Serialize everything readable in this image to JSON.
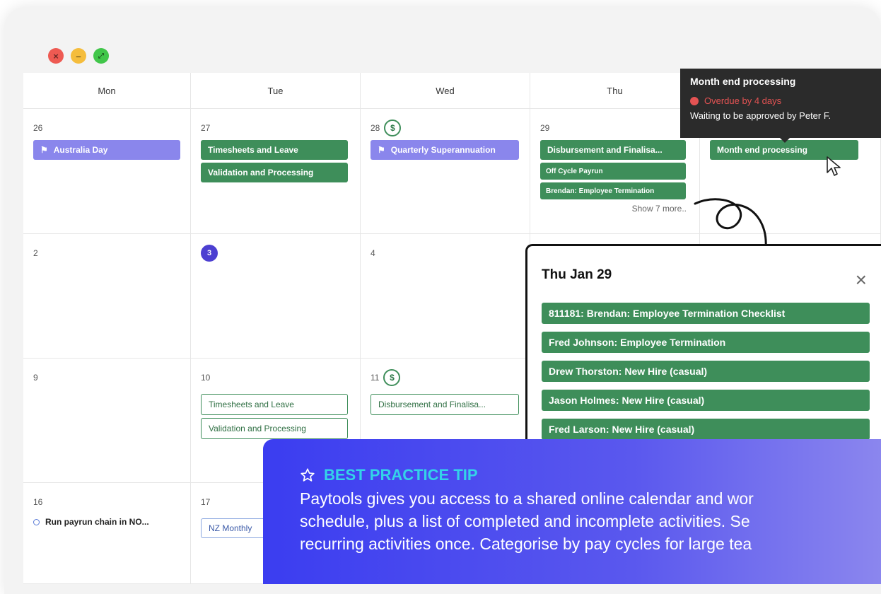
{
  "window": {
    "controls": [
      "close",
      "minimize",
      "fullscreen"
    ]
  },
  "calendar": {
    "days": [
      "Mon",
      "Tue",
      "Wed",
      "Thu"
    ],
    "week1": {
      "mon": {
        "date": "26",
        "events": [
          {
            "label": "Australia Day",
            "icon": "flag-icon"
          }
        ]
      },
      "tue": {
        "date": "27",
        "events": [
          "Timesheets and Leave",
          "Validation and Processing"
        ]
      },
      "wed": {
        "date": "28",
        "badge": "$",
        "events": [
          {
            "label": "Quarterly Superannuation",
            "icon": "flag-icon"
          }
        ]
      },
      "thu": {
        "date": "29",
        "events": [
          "Disbursement and Finalisa...",
          "Off Cycle Payrun",
          "Brendan: Employee Termination"
        ],
        "more": "Show 7 more.."
      },
      "fri": {
        "events": [
          "Month end processing"
        ]
      }
    },
    "week2": {
      "mon": {
        "date": "2"
      },
      "tue": {
        "date": "3"
      },
      "wed": {
        "date": "4"
      }
    },
    "week3": {
      "mon": {
        "date": "9"
      },
      "tue": {
        "date": "10",
        "events": [
          "Timesheets and Leave",
          "Validation and Processing"
        ]
      },
      "wed": {
        "date": "11",
        "badge": "$",
        "events": [
          "Disbursement and Finalisa..."
        ]
      }
    },
    "week4": {
      "mon": {
        "date": "16",
        "events": [
          "Run payrun chain in NO..."
        ]
      },
      "tue": {
        "date": "17",
        "events": [
          "NZ Monthly"
        ]
      }
    }
  },
  "tooltip": {
    "title": "Month end processing",
    "overdue": "Overdue by 4 days",
    "waiting": "Waiting to be approved by Peter F."
  },
  "popup": {
    "title": "Thu Jan 29",
    "close": "×",
    "events": [
      "811181: Brendan: Employee Termination Checklist",
      "Fred Johnson: Employee Termination",
      "Drew Thorston: New Hire (casual)",
      "Jason Holmes: New Hire (casual)",
      "Fred Larson: New Hire (casual)"
    ]
  },
  "tip": {
    "heading": "BEST PRACTICE TIP",
    "lines": [
      "Paytools gives you access to a shared online calendar and wor",
      "schedule, plus a list of completed and incomplete activities. Se",
      "recurring activities once. Categorise by pay cycles for large tea"
    ]
  },
  "colors": {
    "event_green": "#3e8e5a",
    "holiday_purple": "#8a86ec",
    "today": "#4c3fd1",
    "overdue_red": "#e45353",
    "tip_heading": "#34d3e8"
  }
}
